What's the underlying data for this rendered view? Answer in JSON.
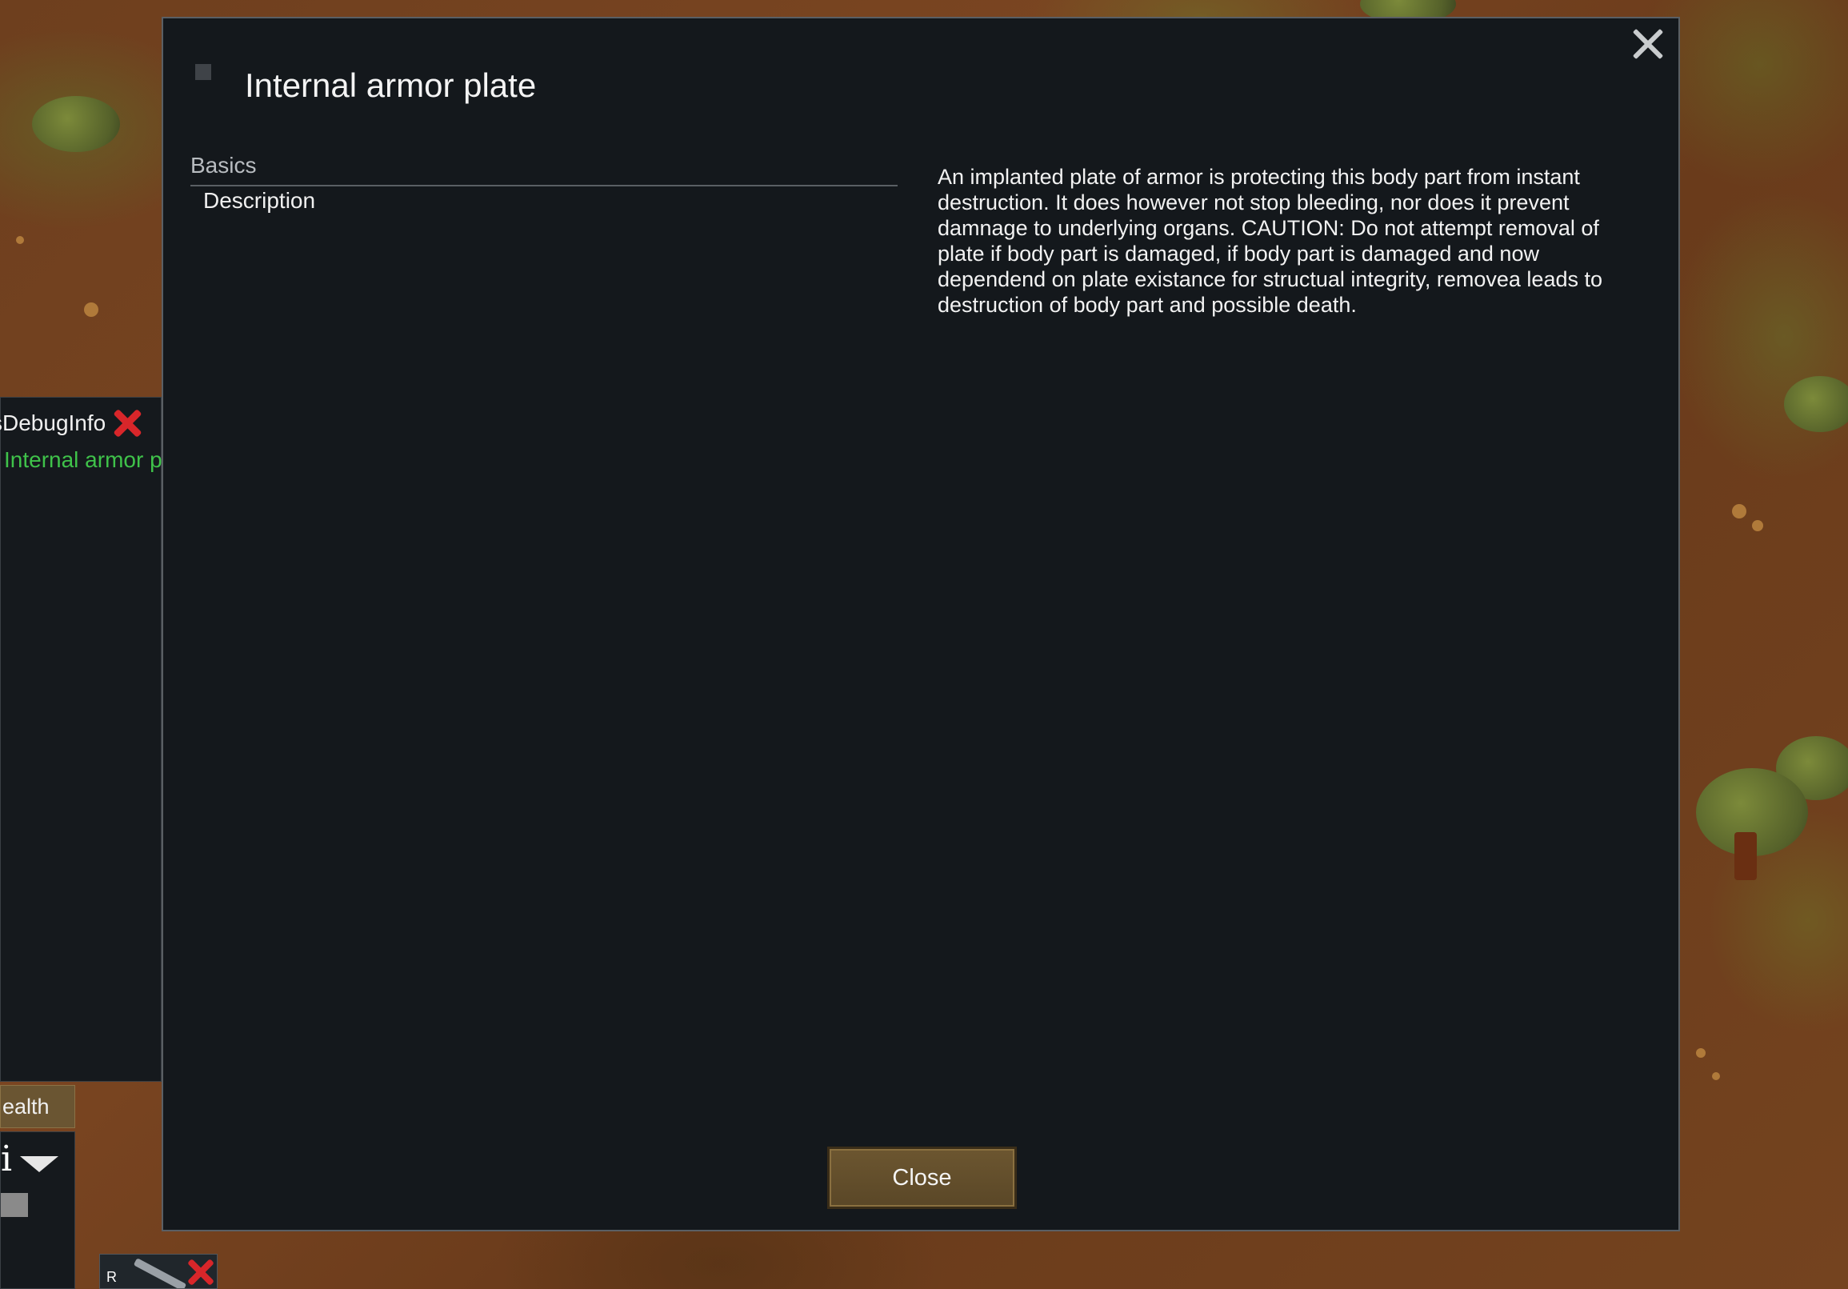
{
  "background": {
    "debug_label": "sDebugInfo",
    "hediff_line": "Internal armor p",
    "health_tab": "ealth",
    "info_glyph": "i",
    "bottom_icon_letter": "R"
  },
  "dialog": {
    "title": "Internal armor plate",
    "section_header": "Basics",
    "section_item": "Description",
    "description": "An implanted plate of armor is protecting this body part from instant destruction. It does however not stop bleeding, nor does it prevent damnage to underlying organs. CAUTION: Do not attempt removal of plate if body part is damaged, if body part is damaged and now dependend on plate existance for structual integrity, removea leads to destruction of body part and possible death.",
    "close_button": "Close"
  },
  "colors": {
    "modal_bg": "#14181c",
    "button_bg": "#6c5630",
    "hediff_green": "#3fc24a",
    "delete_red": "#d8262a"
  }
}
